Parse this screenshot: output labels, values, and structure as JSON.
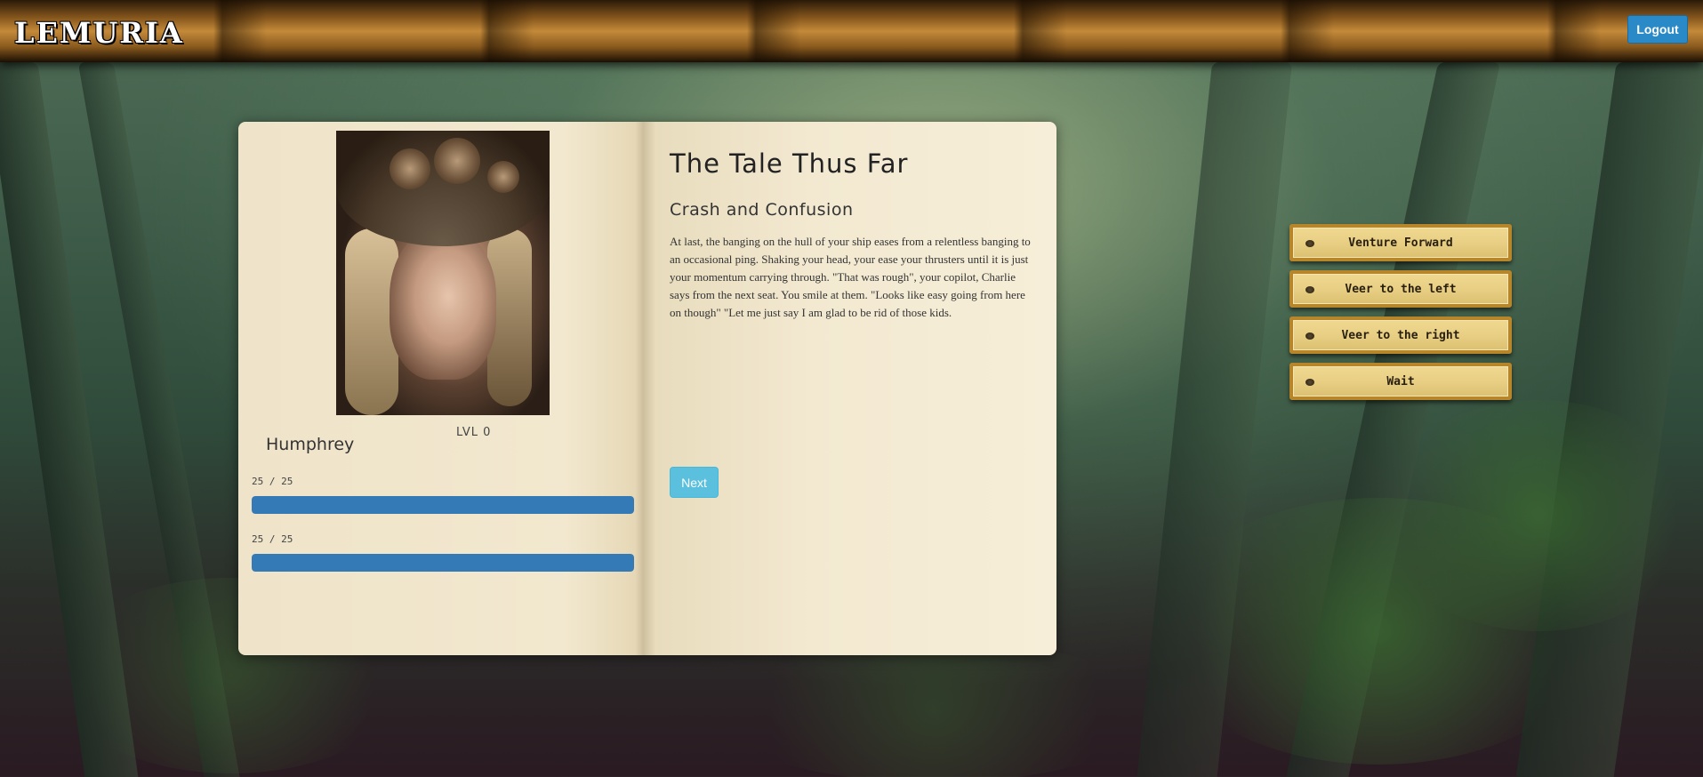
{
  "header": {
    "logo_text": "LEMURIA",
    "logout_label": "Logout"
  },
  "character": {
    "name": "Humphrey",
    "level": "LVL 0",
    "stats": [
      {
        "label": "25 / 25",
        "fill_fraction": 1.0
      },
      {
        "label": "25 / 25",
        "fill_fraction": 1.0
      }
    ]
  },
  "story": {
    "heading": "The Tale Thus Far",
    "chapter": "Crash and Confusion",
    "text": "At last, the banging on the hull of your ship eases from a relentless banging to an occasional ping. Shaking your head, your ease your thrusters until it is just your momentum carrying through. \"That was rough\", your copilot, Charlie says from the next seat. You smile at them. \"Looks like easy going from here on though\" \"Let me just say I am glad to be rid of those kids.",
    "next_label": "Next"
  },
  "choices": [
    {
      "label": "Venture Forward"
    },
    {
      "label": "Veer to the left"
    },
    {
      "label": "Veer to the right"
    },
    {
      "label": "Wait"
    }
  ],
  "colors": {
    "progress_bar": "#337ab7",
    "next_button": "#5bc0de",
    "logout_button": "#2a8ac8",
    "choice_border": "#b8862a"
  }
}
